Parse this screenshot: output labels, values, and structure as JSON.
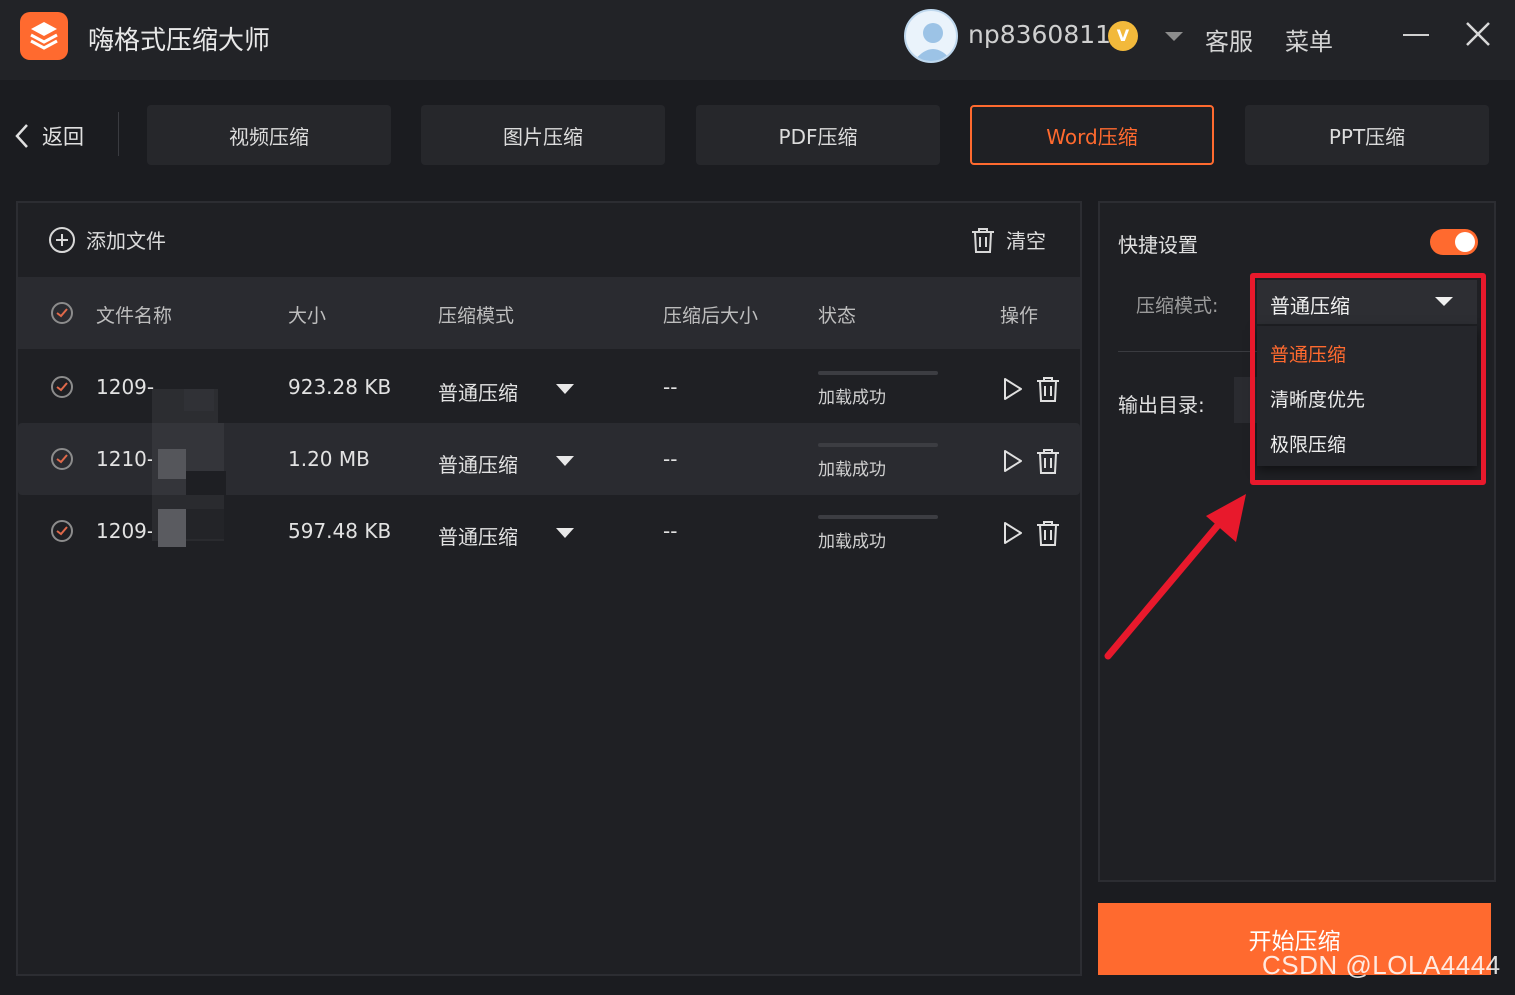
{
  "app": {
    "title": "嗨格式压缩大师",
    "username": "np8360811",
    "vip_badge": "V",
    "support_label": "客服",
    "menu_label": "菜单"
  },
  "nav": {
    "back_label": "返回",
    "tabs": [
      {
        "label": "视频压缩",
        "active": false
      },
      {
        "label": "图片压缩",
        "active": false
      },
      {
        "label": "PDF压缩",
        "active": false
      },
      {
        "label": "Word压缩",
        "active": true
      },
      {
        "label": "PPT压缩",
        "active": false
      }
    ]
  },
  "files": {
    "add_label": "添加文件",
    "clear_label": "清空",
    "columns": [
      "文件名称",
      "大小",
      "压缩模式",
      "压缩后大小",
      "状态",
      "操作"
    ],
    "rows": [
      {
        "name": "1209-",
        "size": "923.28 KB",
        "mode": "普通压缩",
        "compressed_size": "--",
        "status": "加载成功"
      },
      {
        "name": "1210-",
        "size": "1.20 MB",
        "mode": "普通压缩",
        "compressed_size": "--",
        "status": "加载成功"
      },
      {
        "name": "1209-",
        "size": "597.48 KB",
        "mode": "普通压缩",
        "compressed_size": "--",
        "status": "加载成功"
      }
    ]
  },
  "settings": {
    "title": "快捷设置",
    "toggle_on": true,
    "mode_label": "压缩模式:",
    "mode_selected": "普通压缩",
    "mode_options": [
      "普通压缩",
      "清晰度优先",
      "极限压缩"
    ],
    "output_label": "输出目录:"
  },
  "actions": {
    "start_label": "开始压缩"
  },
  "watermark": "CSDN @LOLA4444",
  "colors": {
    "accent": "#ff6a2f",
    "annotation": "#e8192c",
    "background": "#1b1c20"
  }
}
